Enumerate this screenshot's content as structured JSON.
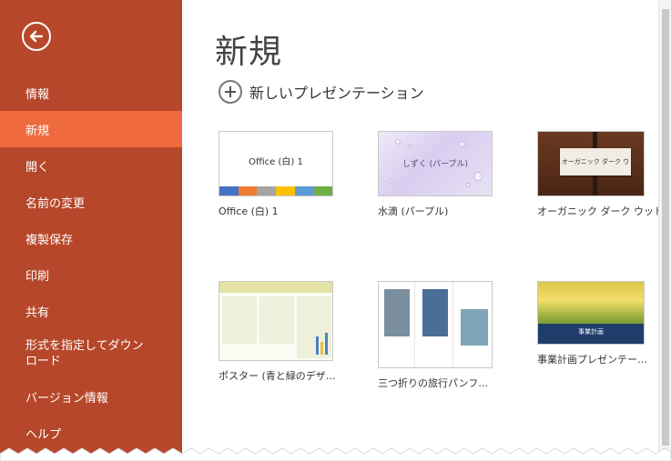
{
  "sidebar": {
    "back_icon": "back-arrow-icon",
    "items": [
      {
        "label": "情報"
      },
      {
        "label": "新規",
        "selected": true
      },
      {
        "label": "開く"
      },
      {
        "label": "名前の変更"
      },
      {
        "label": "複製保存"
      },
      {
        "label": "印刷"
      },
      {
        "label": "共有"
      },
      {
        "label_line1": "形式を指定してダウン",
        "label_line2": "ロード"
      },
      {
        "label": "バージョン情報"
      },
      {
        "label": "ヘルプ"
      }
    ],
    "colors": {
      "background": "#b7472a",
      "selected": "#ef6a3e"
    }
  },
  "main": {
    "title": "新規",
    "new_presentation": "新しいプレゼンテーション",
    "templates": [
      {
        "name": "Office (白) 1",
        "thumb_text": "Office (白) 1"
      },
      {
        "name": "水滴 (パープル)",
        "thumb_text": "しずく (パープル)"
      },
      {
        "name": "オーガニック ダーク ウッド",
        "thumb_text": "オーガニック ダーク ウッド"
      },
      {
        "name": "ポスター (青と緑のデザ…"
      },
      {
        "name": "三つ折りの旅行パンフ…"
      },
      {
        "name": "事業計画プレゼンテー…",
        "thumb_text": "事業計画"
      }
    ],
    "office_stripe_colors": [
      "#4472c4",
      "#ed7d31",
      "#a5a5a5",
      "#ffc000",
      "#5b9bd5",
      "#70ad47"
    ]
  }
}
